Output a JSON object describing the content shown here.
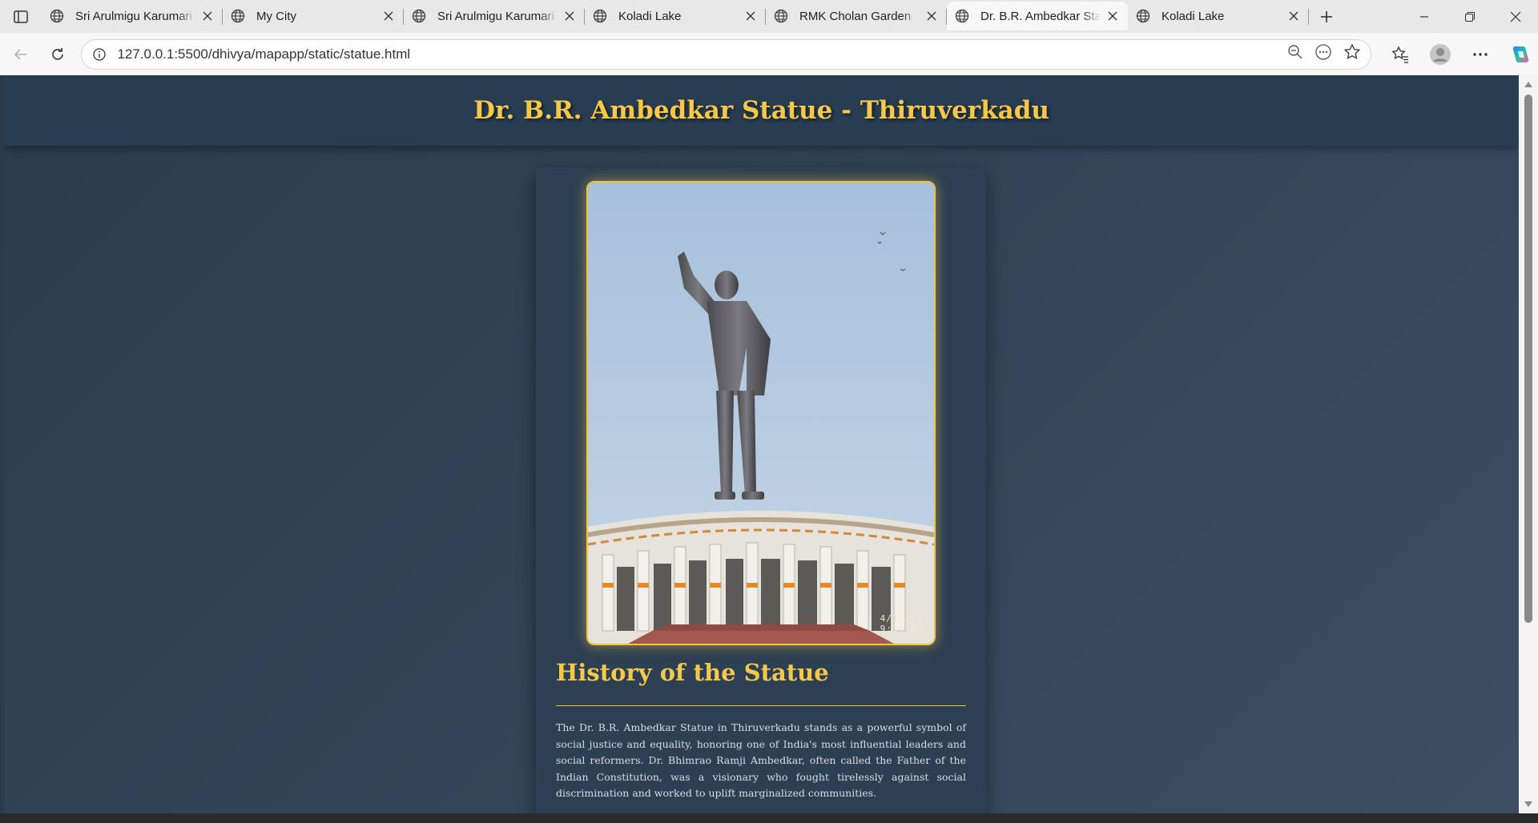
{
  "browser": {
    "tabs": [
      {
        "title": "Sri Arulmigu Karumari",
        "active": false
      },
      {
        "title": "My City",
        "active": false
      },
      {
        "title": "Sri Arulmigu Karumari",
        "active": false
      },
      {
        "title": "Koladi Lake",
        "active": false
      },
      {
        "title": "RMK Cholan Garden",
        "active": false
      },
      {
        "title": "Dr. B.R. Ambedkar Stat",
        "active": true
      },
      {
        "title": "Koladi Lake",
        "active": false
      }
    ],
    "url": "127.0.0.1:5500/dhivya/mapapp/static/statue.html",
    "icons": [
      "sidebar-icon",
      "globe-icon",
      "close-icon",
      "plus-icon",
      "minimize-icon",
      "restore-icon",
      "window-close-icon",
      "back-icon",
      "refresh-icon",
      "info-icon",
      "zoom-out-icon",
      "read-aloud-icon",
      "star-icon",
      "favorites-icon",
      "profile-icon",
      "more-icon",
      "copilot-icon"
    ]
  },
  "page": {
    "title": "Dr. B.R. Ambedkar Statue - Thiruverkadu",
    "photo_timestamp_date": "4/18/23",
    "photo_timestamp_time": "9:34 AM",
    "section_heading": "History of the Statue",
    "history_text": "The Dr. B.R. Ambedkar Statue in Thiruverkadu stands as a powerful symbol of social justice and equality, honoring one of India's most influential leaders and social reformers. Dr. Bhimrao Ramji Ambedkar, often called the Father of the Indian Constitution, was a visionary who fought tirelessly against social discrimination and worked to uplift marginalized communities."
  },
  "colors": {
    "accent_gold": "#f5c84a",
    "page_bg": "#2b3b4c",
    "header_bg": "#293d52"
  }
}
